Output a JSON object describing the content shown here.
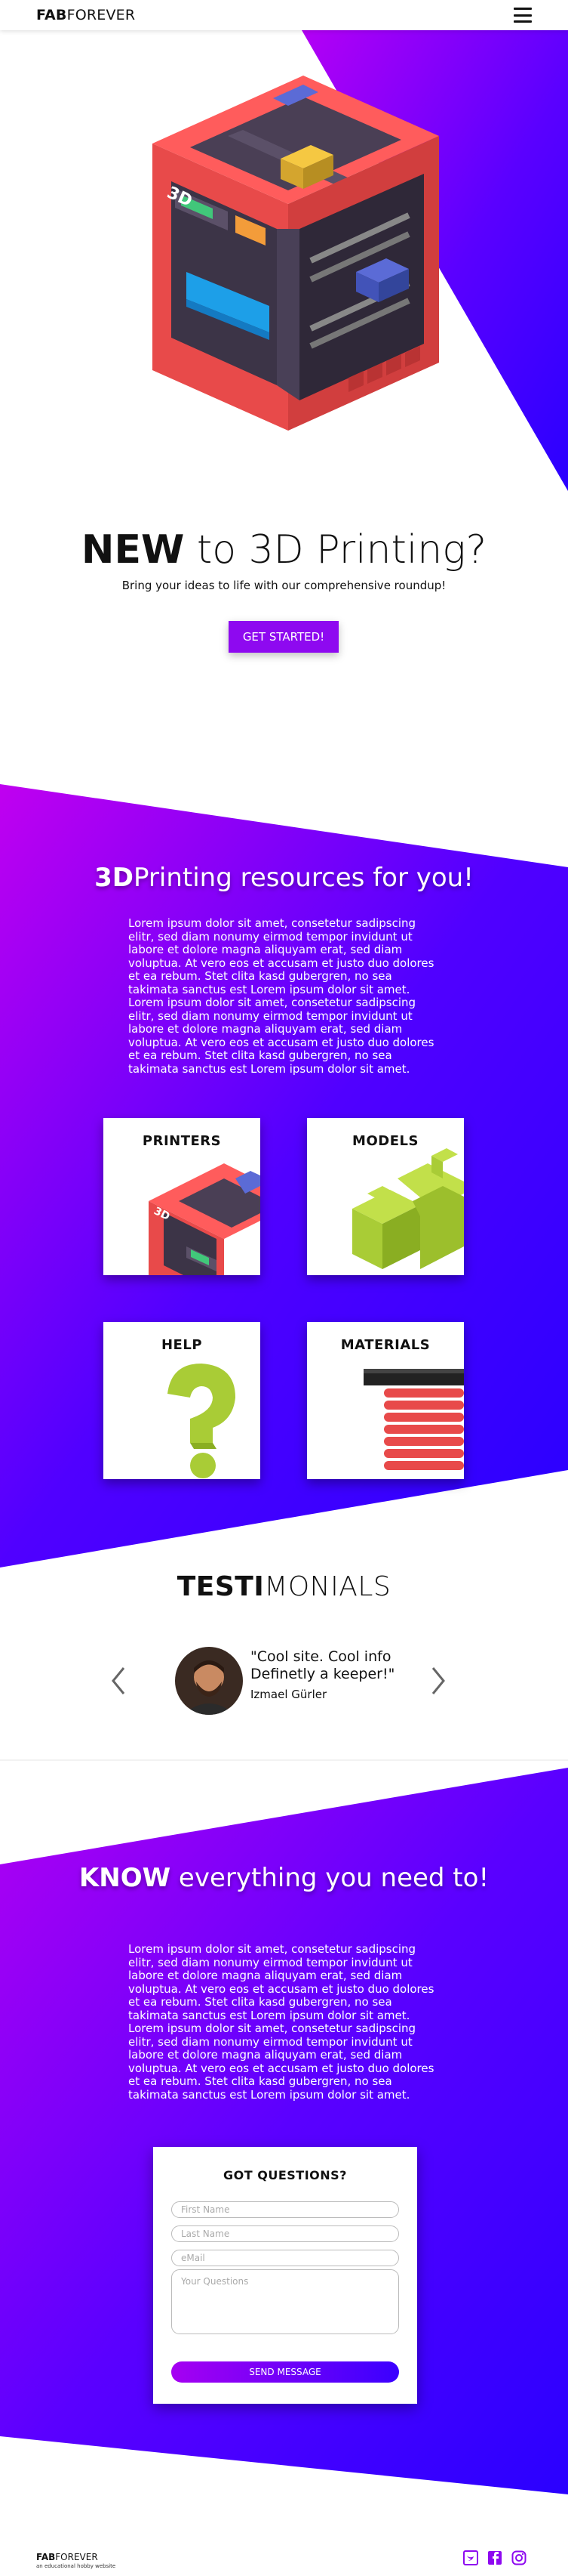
{
  "header": {
    "logo_bold": "FAB",
    "logo_light": "FOREVER"
  },
  "hero": {
    "title_bold": "NEW",
    "title_rest": " to 3D Printing?",
    "subtitle": "Bring your ideas to life with our comprehensive roundup!",
    "cta": "GET STARTED!",
    "printer_badge": "3D"
  },
  "resources": {
    "title_bold": "3D",
    "title_rest": "Printing resources for you!",
    "body": "Lorem ipsum dolor sit amet, consetetur sadipscing elitr, sed diam nonumy eirmod tempor invidunt ut labore et dolore magna aliquyam erat, sed diam voluptua. At vero eos et accusam et justo duo dolores et ea rebum. Stet clita kasd gubergren, no sea takimata sanctus est Lorem ipsum dolor sit amet. Lorem ipsum dolor sit amet, consetetur sadipscing elitr, sed diam nonumy eirmod tempor invidunt ut labore et dolore magna aliquyam erat, sed diam voluptua. At vero eos et accusam et justo duo dolores et ea rebum. Stet clita kasd gubergren, no sea takimata sanctus est Lorem ipsum dolor sit amet.",
    "cards": [
      {
        "label": "PRINTERS"
      },
      {
        "label": "MODELS"
      },
      {
        "label": "HELP"
      },
      {
        "label": "MATERIALS"
      }
    ]
  },
  "testimonials": {
    "title_bold": "TESTI",
    "title_rest": "MONIALS",
    "quote_line1": "\"Cool site. Cool info",
    "quote_line2": "Definetly a keeper!\"",
    "author": "Izmael Gürler"
  },
  "know": {
    "title_bold": "KNOW",
    "title_rest": " everything you need to!",
    "body": "Lorem ipsum dolor sit amet, consetetur sadipscing elitr, sed diam nonumy eirmod tempor invidunt ut labore et dolore magna aliquyam erat, sed diam voluptua. At vero eos et accusam et justo duo dolores et ea rebum. Stet clita kasd gubergren, no sea takimata sanctus est Lorem ipsum dolor sit amet. Lorem ipsum dolor sit amet, consetetur sadipscing elitr, sed diam nonumy eirmod tempor invidunt ut labore et dolore magna aliquyam erat, sed diam voluptua. At vero eos et accusam et justo duo dolores et ea rebum. Stet clita kasd gubergren, no sea takimata sanctus est Lorem ipsum dolor sit amet."
  },
  "form": {
    "title": "GOT QUESTIONS?",
    "first_name": "First Name",
    "last_name": "Last Name",
    "email": "eMail",
    "questions": "Your Questions",
    "submit": "SEND MESSAGE"
  },
  "footer": {
    "logo_bold": "FAB",
    "logo_light": "FOREVER",
    "tagline": "an educational hobby website",
    "social": [
      "twitter-icon",
      "facebook-icon",
      "instagram-icon"
    ]
  },
  "colors": {
    "accent": "#8e09f0",
    "gradient_start": "#b400f5",
    "gradient_end": "#2a00ff",
    "printer_red": "#e84a4a",
    "model_green": "#a9cc36"
  }
}
